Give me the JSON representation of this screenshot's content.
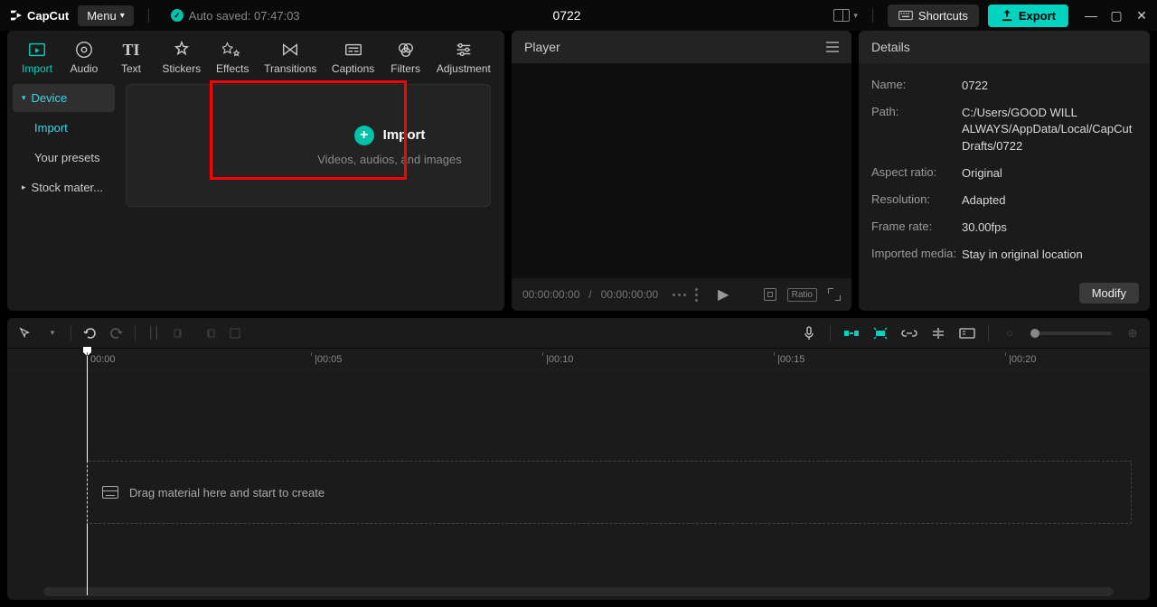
{
  "titlebar": {
    "app_name": "CapCut",
    "menu_label": "Menu",
    "autosave_label": "Auto saved: 07:47:03",
    "project_title": "0722",
    "shortcuts_label": "Shortcuts",
    "export_label": "Export"
  },
  "tabs": {
    "import": "Import",
    "audio": "Audio",
    "text": "Text",
    "stickers": "Stickers",
    "effects": "Effects",
    "transitions": "Transitions",
    "captions": "Captions",
    "filters": "Filters",
    "adjustment": "Adjustment"
  },
  "subnav": {
    "device": "Device",
    "import": "Import",
    "your_presets": "Your presets",
    "stock": "Stock mater..."
  },
  "import_card": {
    "title": "Import",
    "subtitle": "Videos, audios, and images"
  },
  "player": {
    "title": "Player",
    "time_current": "00:00:00:00",
    "time_sep": " / ",
    "time_total": "00:00:00:00",
    "ratio_label": "Ratio"
  },
  "details": {
    "title": "Details",
    "name_label": "Name:",
    "name_value": "0722",
    "path_label": "Path:",
    "path_value": "C:/Users/GOOD WILL ALWAYS/AppData/Local/CapCut Drafts/0722",
    "aspect_label": "Aspect ratio:",
    "aspect_value": "Original",
    "resolution_label": "Resolution:",
    "resolution_value": "Adapted",
    "framerate_label": "Frame rate:",
    "framerate_value": "30.00fps",
    "imported_label": "Imported media:",
    "imported_value": "Stay in original location",
    "modify_label": "Modify"
  },
  "ruler": {
    "t0": "00:00",
    "t5": "|00:05",
    "t10": "|00:10",
    "t15": "|00:15",
    "t20": "|00:20"
  },
  "timeline": {
    "drop_hint": "Drag material here and start to create"
  }
}
